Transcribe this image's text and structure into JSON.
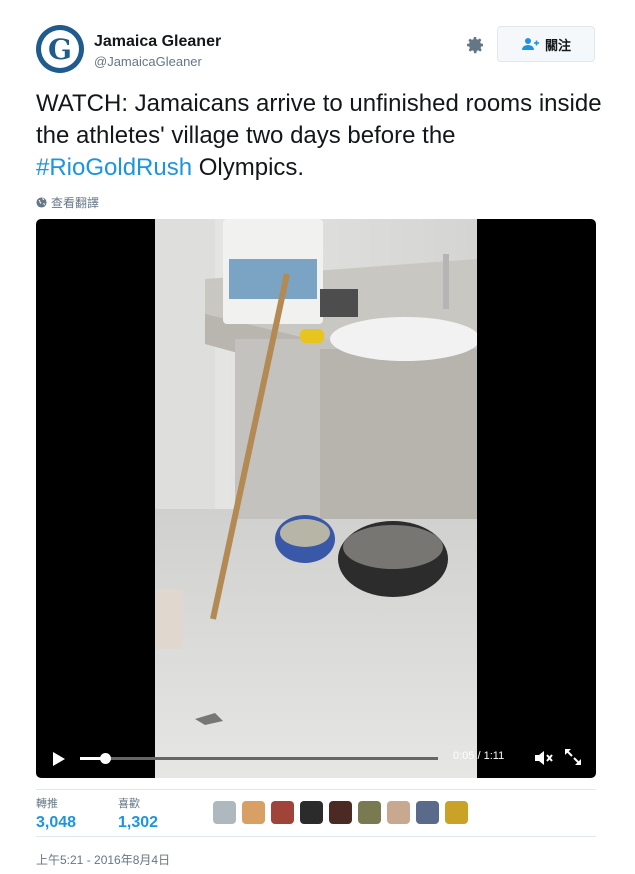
{
  "author": {
    "name": "Jamaica Gleaner",
    "handle": "@JamaicaGleaner",
    "avatar_letter": "G"
  },
  "follow_button": {
    "label": "關注",
    "icon": "add-user-icon"
  },
  "settings_icon": "gear-icon",
  "tweet": {
    "text_before": "WATCH: Jamaicans arrive to unfinished rooms inside the athletes' village two days before the ",
    "hashtag": "#RioGoldRush",
    "text_after": " Olympics.",
    "translate_label": "查看翻譯",
    "translate_icon": "globe-icon"
  },
  "video": {
    "current_time": "0:05",
    "separator": " / ",
    "duration": "1:11",
    "progress": 0.07,
    "play_icon": "play-icon",
    "mute_icon": "mute-icon",
    "fullscreen_icon": "fullscreen-icon"
  },
  "stats": {
    "retweets_label": "轉推",
    "retweets_count": "3,048",
    "likes_label": "喜歡",
    "likes_count": "1,302"
  },
  "likers": [
    {
      "color": "#b0b8bf"
    },
    {
      "color": "#d9a066"
    },
    {
      "color": "#a0443a"
    },
    {
      "color": "#2b2b2b"
    },
    {
      "color": "#4a2a22"
    },
    {
      "color": "#7a7a52"
    },
    {
      "color": "#c8a890"
    },
    {
      "color": "#5a6a8a"
    },
    {
      "color": "#c9a227"
    }
  ],
  "timestamp": "上午5:21 - 2016年8月4日",
  "colors": {
    "link": "#1b95e0",
    "secondary": "#657786",
    "text": "#14171a"
  }
}
